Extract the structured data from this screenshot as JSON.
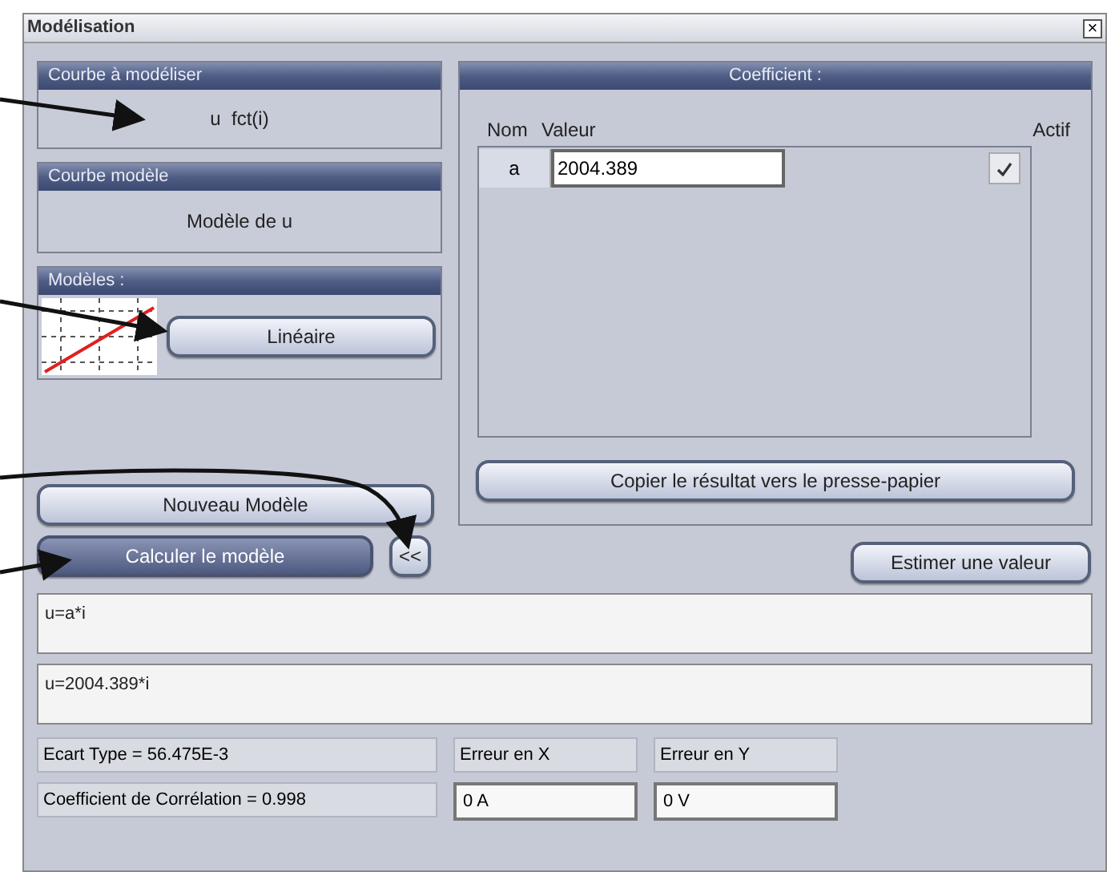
{
  "window": {
    "title": "Modélisation",
    "close": "×"
  },
  "courbe_a_modeliser": {
    "title": "Courbe à modéliser",
    "value": "u  fct(i)"
  },
  "courbe_modele": {
    "title": "Courbe modèle",
    "value": "Modèle de u"
  },
  "modeles": {
    "title": "Modèles :",
    "button": "Linéaire"
  },
  "buttons": [
    {
      "label": "Nouveau Modèle",
      "highlighted": false
    },
    {
      "label": "Calculer le modèle",
      "highlighted": true
    }
  ],
  "toggle_button": "<<",
  "coefficient": {
    "title": "Coefficient :",
    "columns": [
      "Nom",
      "Valeur",
      "Actif"
    ],
    "rows": [
      {
        "name": "a",
        "value": "2004.389",
        "checked": true
      }
    ],
    "copy_button": "Copier le résultat vers le presse-papier"
  },
  "estimate_button": "Estimer une valeur",
  "model_equation": "u=a*i",
  "result_equation": "u=2004.389*i",
  "stats": {
    "ecart_type": "Ecart Type = 56.475E-3",
    "correlation": "Coefficient de Corrélation = 0.998",
    "error_x_label": "Erreur en X",
    "error_y_label": "Erreur en Y",
    "error_x": "0 A",
    "error_y": "0 V"
  }
}
